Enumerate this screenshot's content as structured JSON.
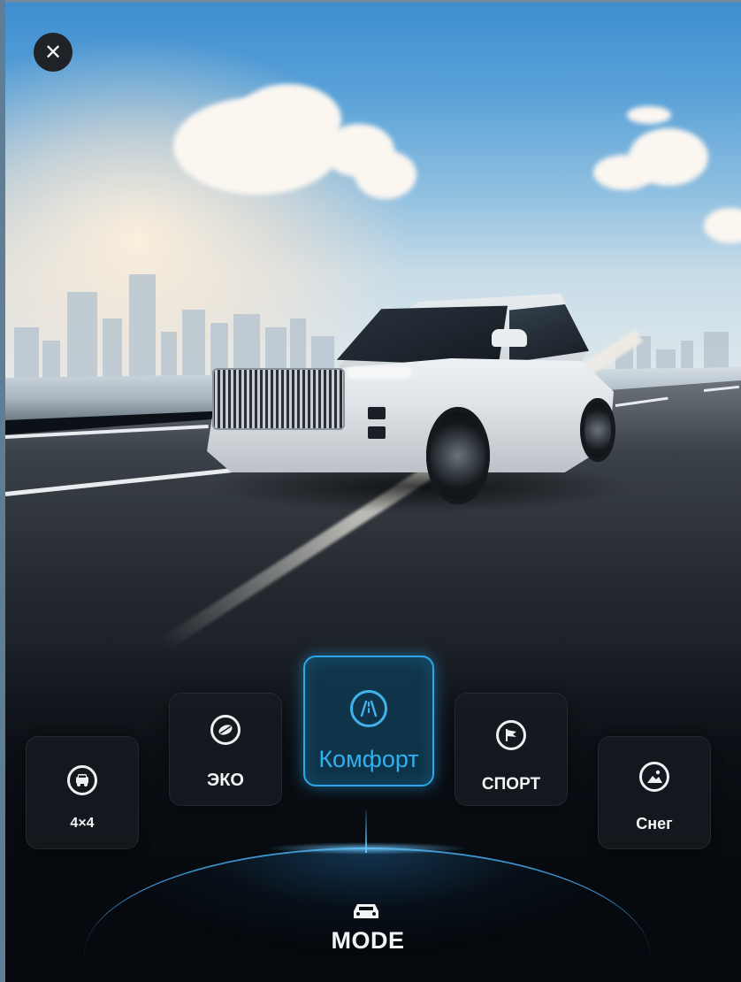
{
  "close_button": {
    "icon": "close-icon"
  },
  "modes": [
    {
      "id": "4x4",
      "label": "4×4",
      "icon": "offroad-car-icon",
      "active": false
    },
    {
      "id": "eco",
      "label": "ЭКО",
      "icon": "eco-leaf-icon",
      "active": false
    },
    {
      "id": "comfort",
      "label": "Комфорт",
      "icon": "road-icon",
      "active": true
    },
    {
      "id": "sport",
      "label": "СПОРТ",
      "icon": "flag-icon",
      "active": false
    },
    {
      "id": "snow",
      "label": "Снег",
      "icon": "snow-icon",
      "active": false
    }
  ],
  "mode_selector": {
    "label": "MODE",
    "icon": "car-icon"
  },
  "colors": {
    "accent": "#2fb0f0",
    "tile_bg": "#161b21",
    "text": "#f2f4f5"
  }
}
